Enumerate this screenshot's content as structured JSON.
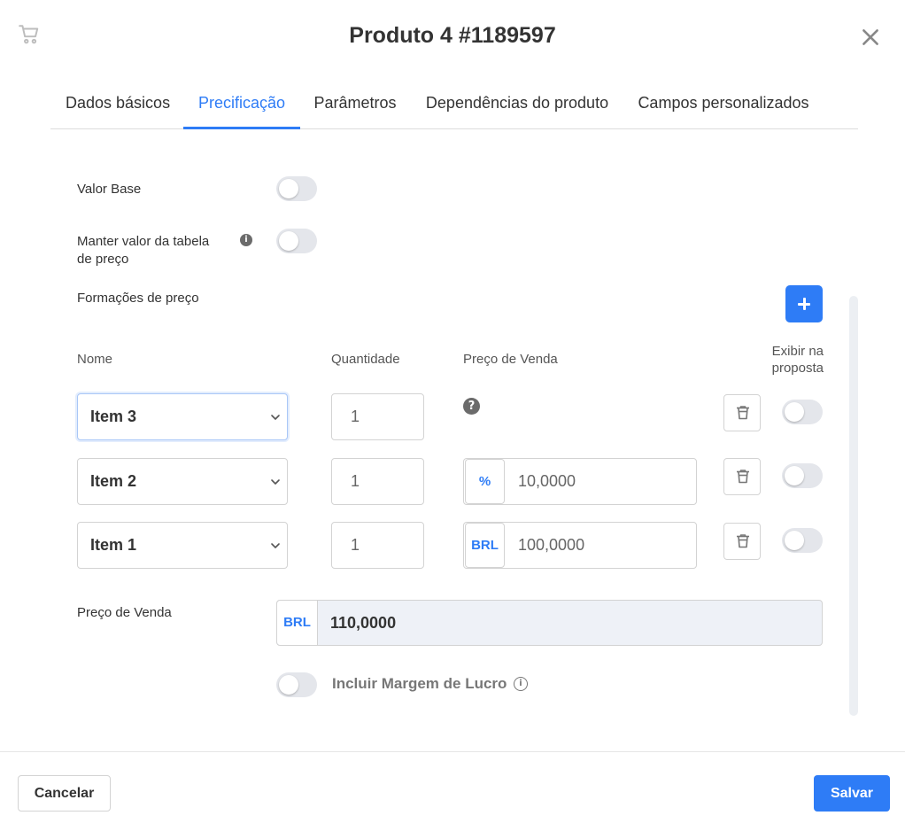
{
  "header": {
    "title": "Produto 4 #1189597",
    "cart_icon": "cart-icon",
    "close_icon": "close-icon"
  },
  "tabs": [
    {
      "label": "Dados básicos",
      "active": false
    },
    {
      "label": "Precificação",
      "active": true
    },
    {
      "label": "Parâmetros",
      "active": false
    },
    {
      "label": "Dependências do produto",
      "active": false
    },
    {
      "label": "Campos personalizados",
      "active": false
    }
  ],
  "form": {
    "valor_base_label": "Valor Base",
    "manter_valor_label": "Manter valor da tabela de preço",
    "manter_valor_info_glyph": "i",
    "formacoes_label": "Formações de preço"
  },
  "table": {
    "headers": {
      "nome": "Nome",
      "quantidade": "Quantidade",
      "preco": "Preço de Venda",
      "exibir": "Exibir na proposta"
    },
    "help_glyph": "?",
    "rows": [
      {
        "item": "Item 3",
        "qty": "1",
        "unit": "",
        "price": "",
        "exibir": false
      },
      {
        "item": "Item 2",
        "qty": "1",
        "unit": "%",
        "price": "10,0000",
        "exibir": false
      },
      {
        "item": "Item 1",
        "qty": "1",
        "unit": "BRL",
        "price": "100,0000",
        "exibir": false
      }
    ]
  },
  "total": {
    "label": "Preço de Venda",
    "unit": "BRL",
    "value": "110,0000"
  },
  "margin": {
    "label": "Incluir Margem de Lucro",
    "info_glyph": "i",
    "enabled": false
  },
  "footer": {
    "cancel_label": "Cancelar",
    "save_label": "Salvar"
  },
  "colors": {
    "accent": "#2e7cf6",
    "toggle_off": "#e4e6eb",
    "total_bg": "#eef1f7"
  }
}
